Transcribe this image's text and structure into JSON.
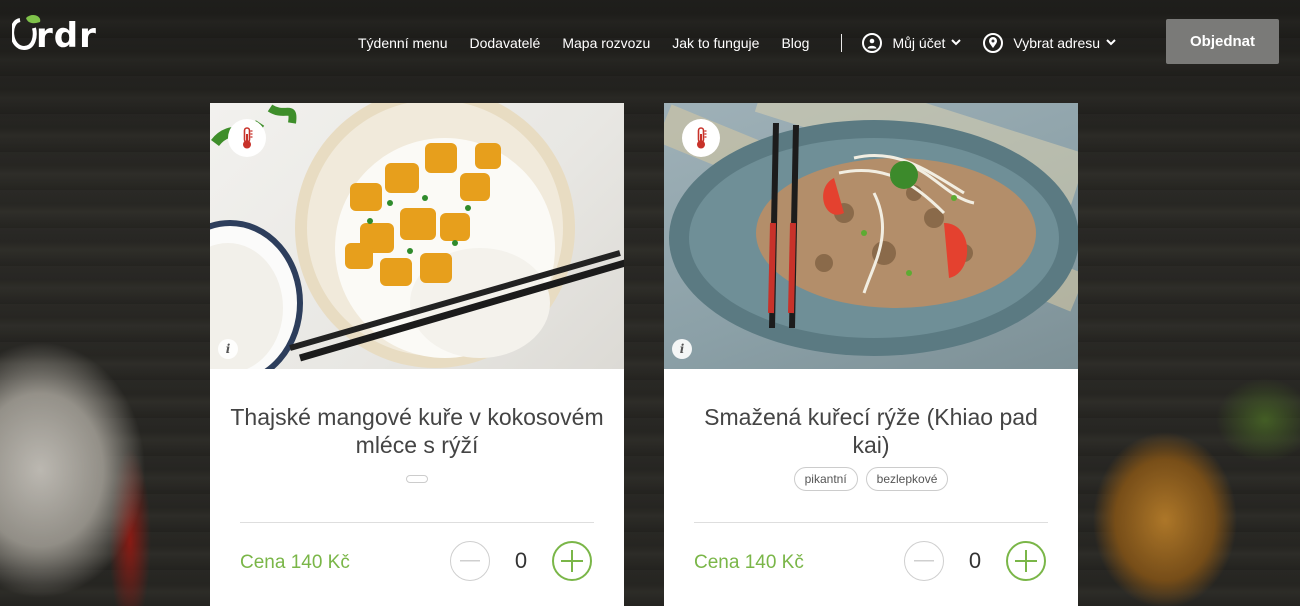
{
  "header": {
    "logo_text": "Ordr",
    "nav": [
      "Týdenní menu",
      "Dodavatelé",
      "Mapa rozvozu",
      "Jak to funguje",
      "Blog"
    ],
    "account_label": "Můj účet",
    "address_label": "Vybrat adresu",
    "order_button": "Objednat"
  },
  "cards": [
    {
      "title": "Thajské mangové kuře v kokosovém mléce s rýží",
      "tags": [],
      "price": "Cena 140 Kč",
      "quantity": "0"
    },
    {
      "title": "Smažená kuřecí rýže (Khiao pad kai)",
      "tags": [
        "pikantní",
        "bezlepkové"
      ],
      "price": "Cena 140 Kč",
      "quantity": "0"
    }
  ],
  "colors": {
    "accent": "#7ab648",
    "order_button": "#7a7a78"
  },
  "icons": [
    "user-icon",
    "location-pin-icon",
    "chevron-down-icon",
    "thermometer-icon",
    "info-icon",
    "minus-icon",
    "plus-icon"
  ]
}
